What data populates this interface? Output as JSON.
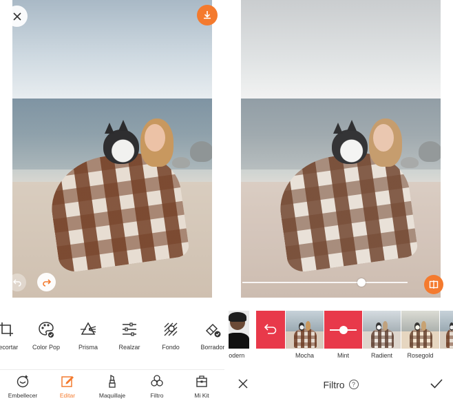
{
  "left_screen": {
    "tools": [
      {
        "label": "Recortar",
        "icon": "crop-icon"
      },
      {
        "label": "Color Pop",
        "icon": "palette-icon"
      },
      {
        "label": "Prisma",
        "icon": "prism-icon"
      },
      {
        "label": "Realzar",
        "icon": "sliders-icon"
      },
      {
        "label": "Fondo",
        "icon": "background-icon"
      },
      {
        "label": "Borrador",
        "icon": "eraser-icon"
      }
    ],
    "bottom_nav": [
      {
        "label": "Embellecer",
        "icon": "beautify-icon",
        "active": false
      },
      {
        "label": "Editar",
        "icon": "edit-icon",
        "active": true
      },
      {
        "label": "Maquillaje",
        "icon": "lipstick-icon",
        "active": false
      },
      {
        "label": "Filtro",
        "icon": "filter-circles-icon",
        "active": false
      },
      {
        "label": "Mi Kit",
        "icon": "kit-icon",
        "active": false
      }
    ],
    "accent_color": "#f47a2e"
  },
  "right_screen": {
    "slider": {
      "value": 0.72
    },
    "filters": [
      {
        "label": "Modern",
        "selected": false
      },
      {
        "label": "",
        "selected": false,
        "icon": "undo-arrow-icon"
      },
      {
        "label": "Mocha",
        "selected": false
      },
      {
        "label": "Mint",
        "selected": true,
        "icon": "slider-icon"
      },
      {
        "label": "Radient",
        "selected": false
      },
      {
        "label": "Rosegold",
        "selected": false
      },
      {
        "label": "",
        "selected": false
      }
    ],
    "bar": {
      "title": "Filtro",
      "help": "?"
    },
    "selected_color": "#e8394a"
  }
}
